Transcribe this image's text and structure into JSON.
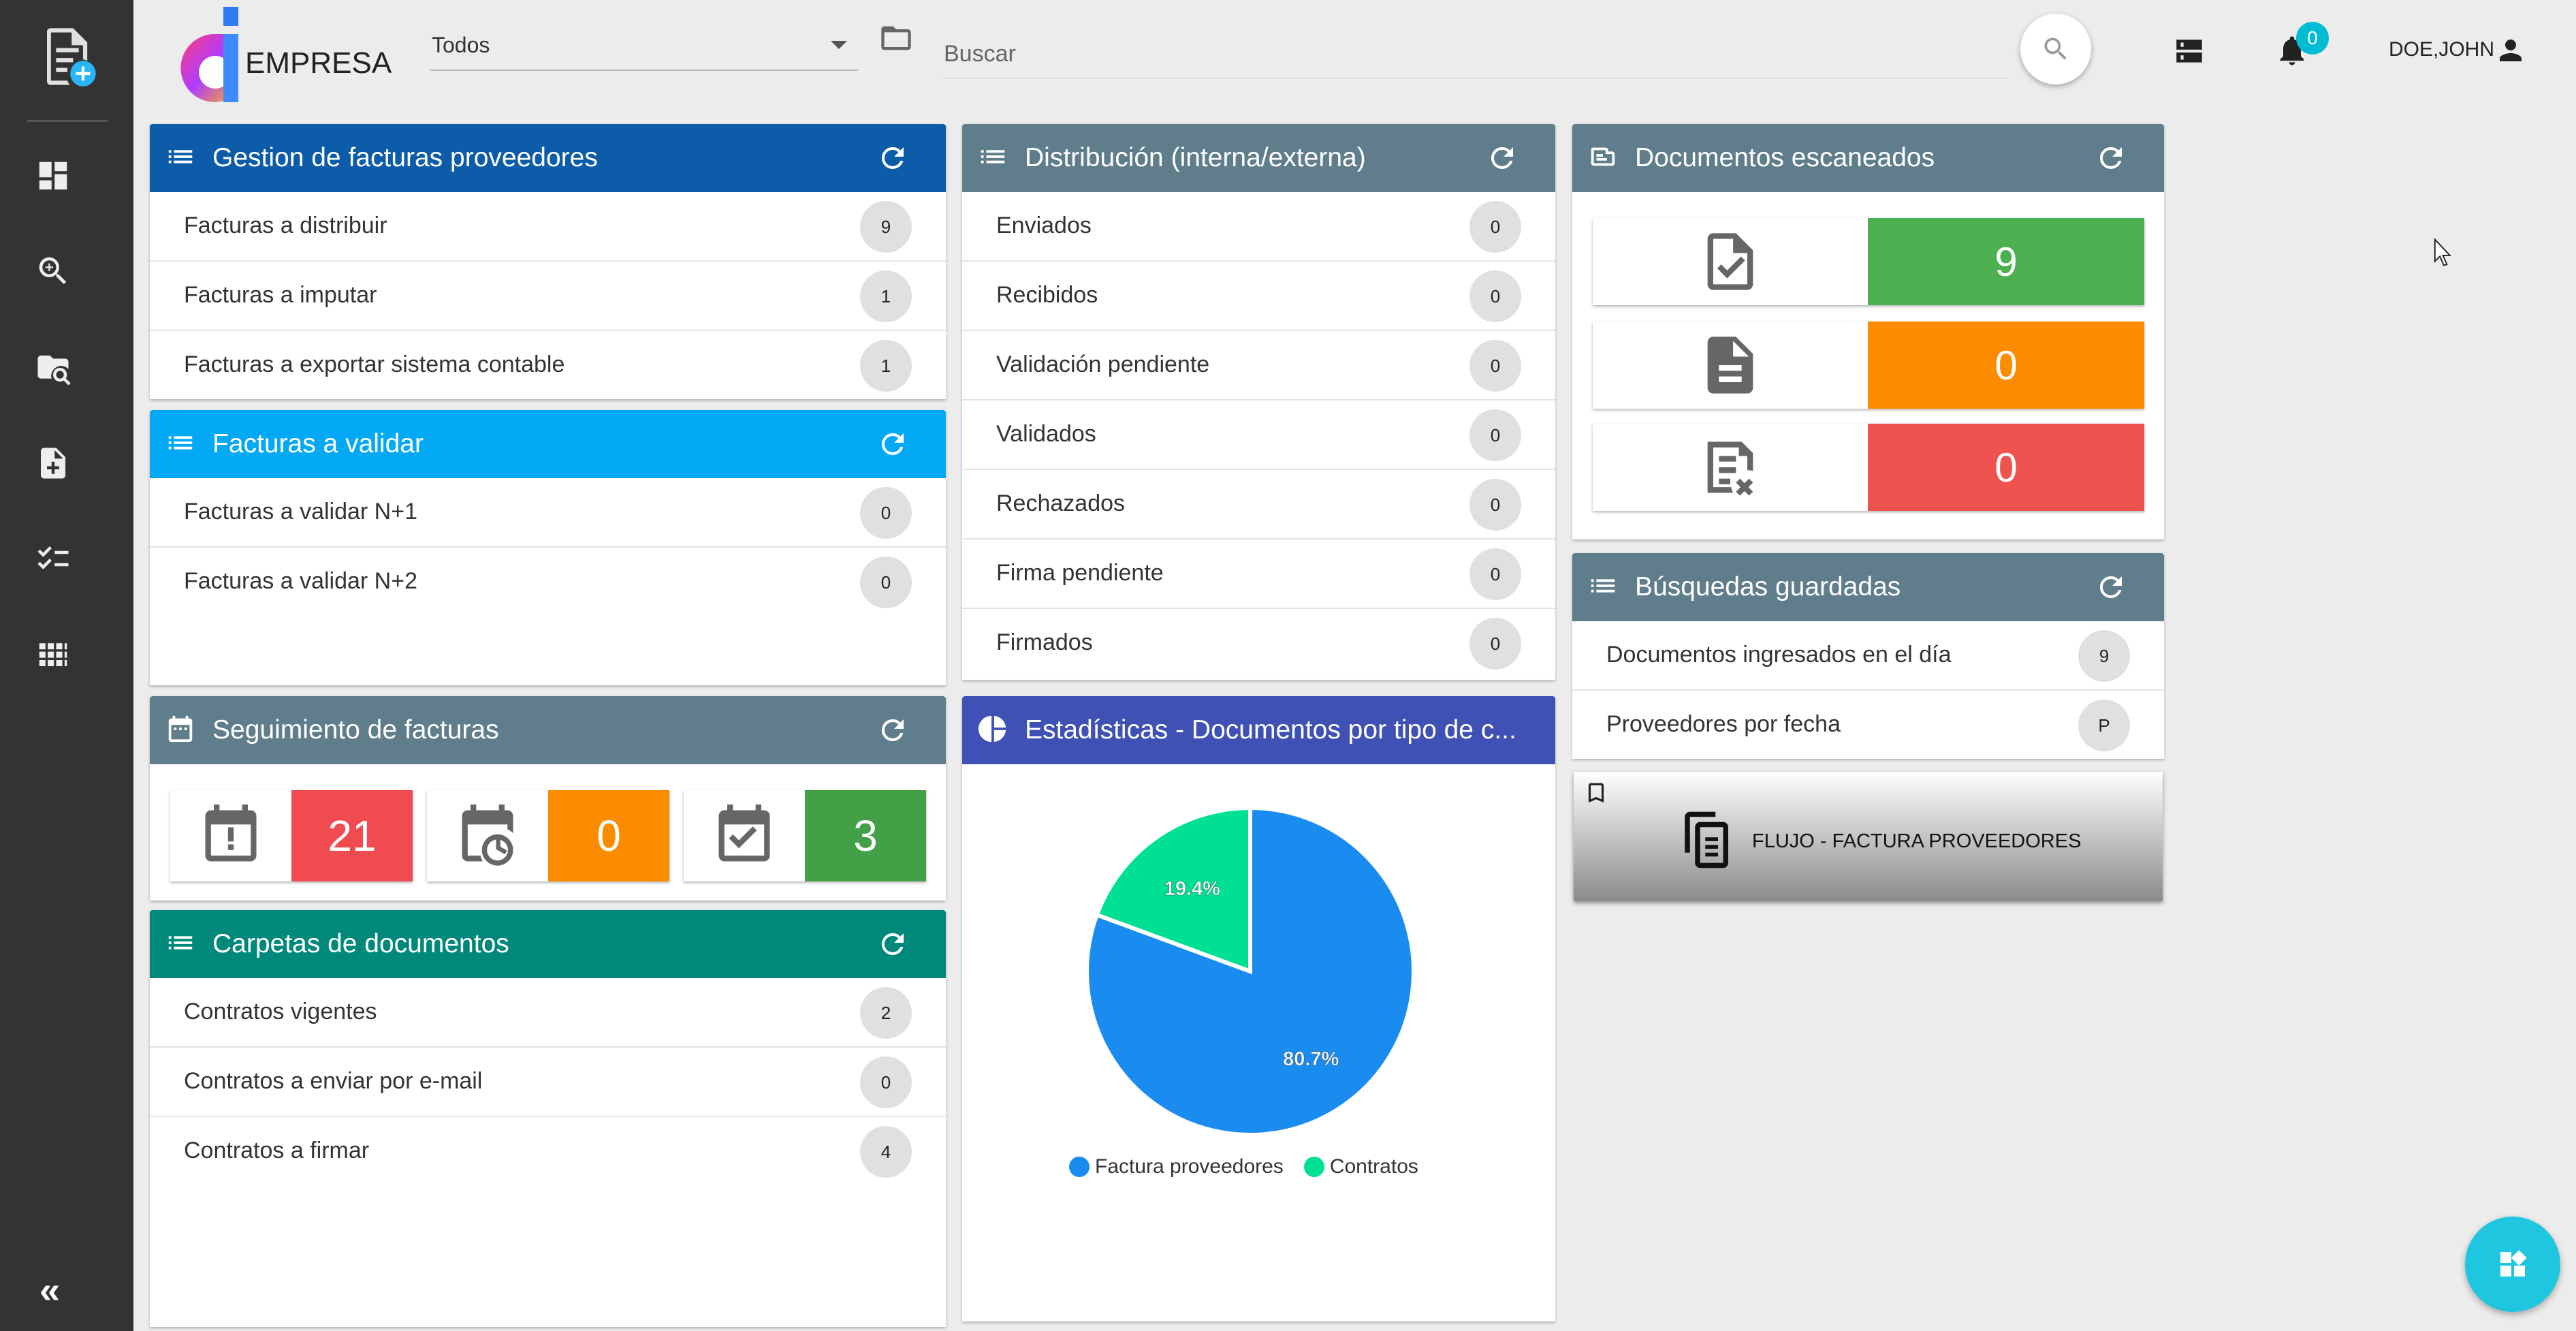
{
  "header": {
    "logo_text": "EMPRESA",
    "company_select_value": "Todos",
    "search_placeholder": "Buscar",
    "notifications_count": "0",
    "user_name": "DOE,JOHN"
  },
  "panels": {
    "gestion": {
      "title": "Gestion de facturas proveedores",
      "color": "#0d5caa",
      "rows": [
        {
          "label": "Facturas a distribuir",
          "count": "9"
        },
        {
          "label": "Facturas a imputar",
          "count": "1"
        },
        {
          "label": "Facturas a exportar sistema contable",
          "count": "1"
        }
      ]
    },
    "validar": {
      "title": "Facturas a validar",
      "color": "#03a9f4",
      "rows": [
        {
          "label": "Facturas a validar N+1",
          "count": "0"
        },
        {
          "label": "Facturas a validar N+2",
          "count": "0"
        }
      ]
    },
    "seguimiento": {
      "title": "Seguimiento de facturas",
      "color": "#607d8b",
      "stats": [
        {
          "icon": "calendar-alert-icon",
          "value": "21",
          "color": "#ef4b51"
        },
        {
          "icon": "calendar-clock-icon",
          "value": "0",
          "color": "#fb8c00"
        },
        {
          "icon": "calendar-check-icon",
          "value": "3",
          "color": "#43a047"
        }
      ]
    },
    "carpetas": {
      "title": "Carpetas de documentos",
      "color": "#00897b",
      "rows": [
        {
          "label": "Contratos vigentes",
          "count": "2"
        },
        {
          "label": "Contratos a enviar por e-mail",
          "count": "0"
        },
        {
          "label": "Contratos a firmar",
          "count": "4"
        }
      ]
    },
    "distribucion": {
      "title": "Distribución (interna/externa)",
      "color": "#607d8b",
      "rows": [
        {
          "label": "Enviados",
          "count": "0"
        },
        {
          "label": "Recibidos",
          "count": "0"
        },
        {
          "label": "Validación pendiente",
          "count": "0"
        },
        {
          "label": "Validados",
          "count": "0"
        },
        {
          "label": "Rechazados",
          "count": "0"
        },
        {
          "label": "Firma pendiente",
          "count": "0"
        },
        {
          "label": "Firmados",
          "count": "0"
        }
      ]
    },
    "estadisticas": {
      "title": "Estadísticas - Documentos por tipo de c...",
      "color": "#3f51b5"
    },
    "escaneados": {
      "title": "Documentos escaneados",
      "color": "#607d8b",
      "stats": [
        {
          "icon": "file-check-icon",
          "value": "9",
          "color": "#4caf50"
        },
        {
          "icon": "file-document-icon",
          "value": "0",
          "color": "#fb8c00"
        },
        {
          "icon": "file-cancel-icon",
          "value": "0",
          "color": "#ef5350"
        }
      ]
    },
    "busquedas": {
      "title": "Búsquedas guardadas",
      "color": "#607d8b",
      "rows": [
        {
          "label": "Documentos ingresados en el día",
          "count": "9"
        },
        {
          "label": "Proveedores por fecha",
          "count": "P"
        }
      ]
    },
    "flujo": {
      "label": "FLUJO - FACTURA PROVEEDORES"
    }
  },
  "chart_data": {
    "type": "pie",
    "title": "Estadísticas - Documentos por tipo de c...",
    "slices": [
      {
        "name": "Factura proveedores",
        "value": 80.7,
        "label": "80.7%",
        "color": "#1a8cf0"
      },
      {
        "name": "Contratos",
        "value": 19.4,
        "label": "19.4%",
        "color": "#00e095"
      }
    ],
    "legend_position": "bottom"
  }
}
